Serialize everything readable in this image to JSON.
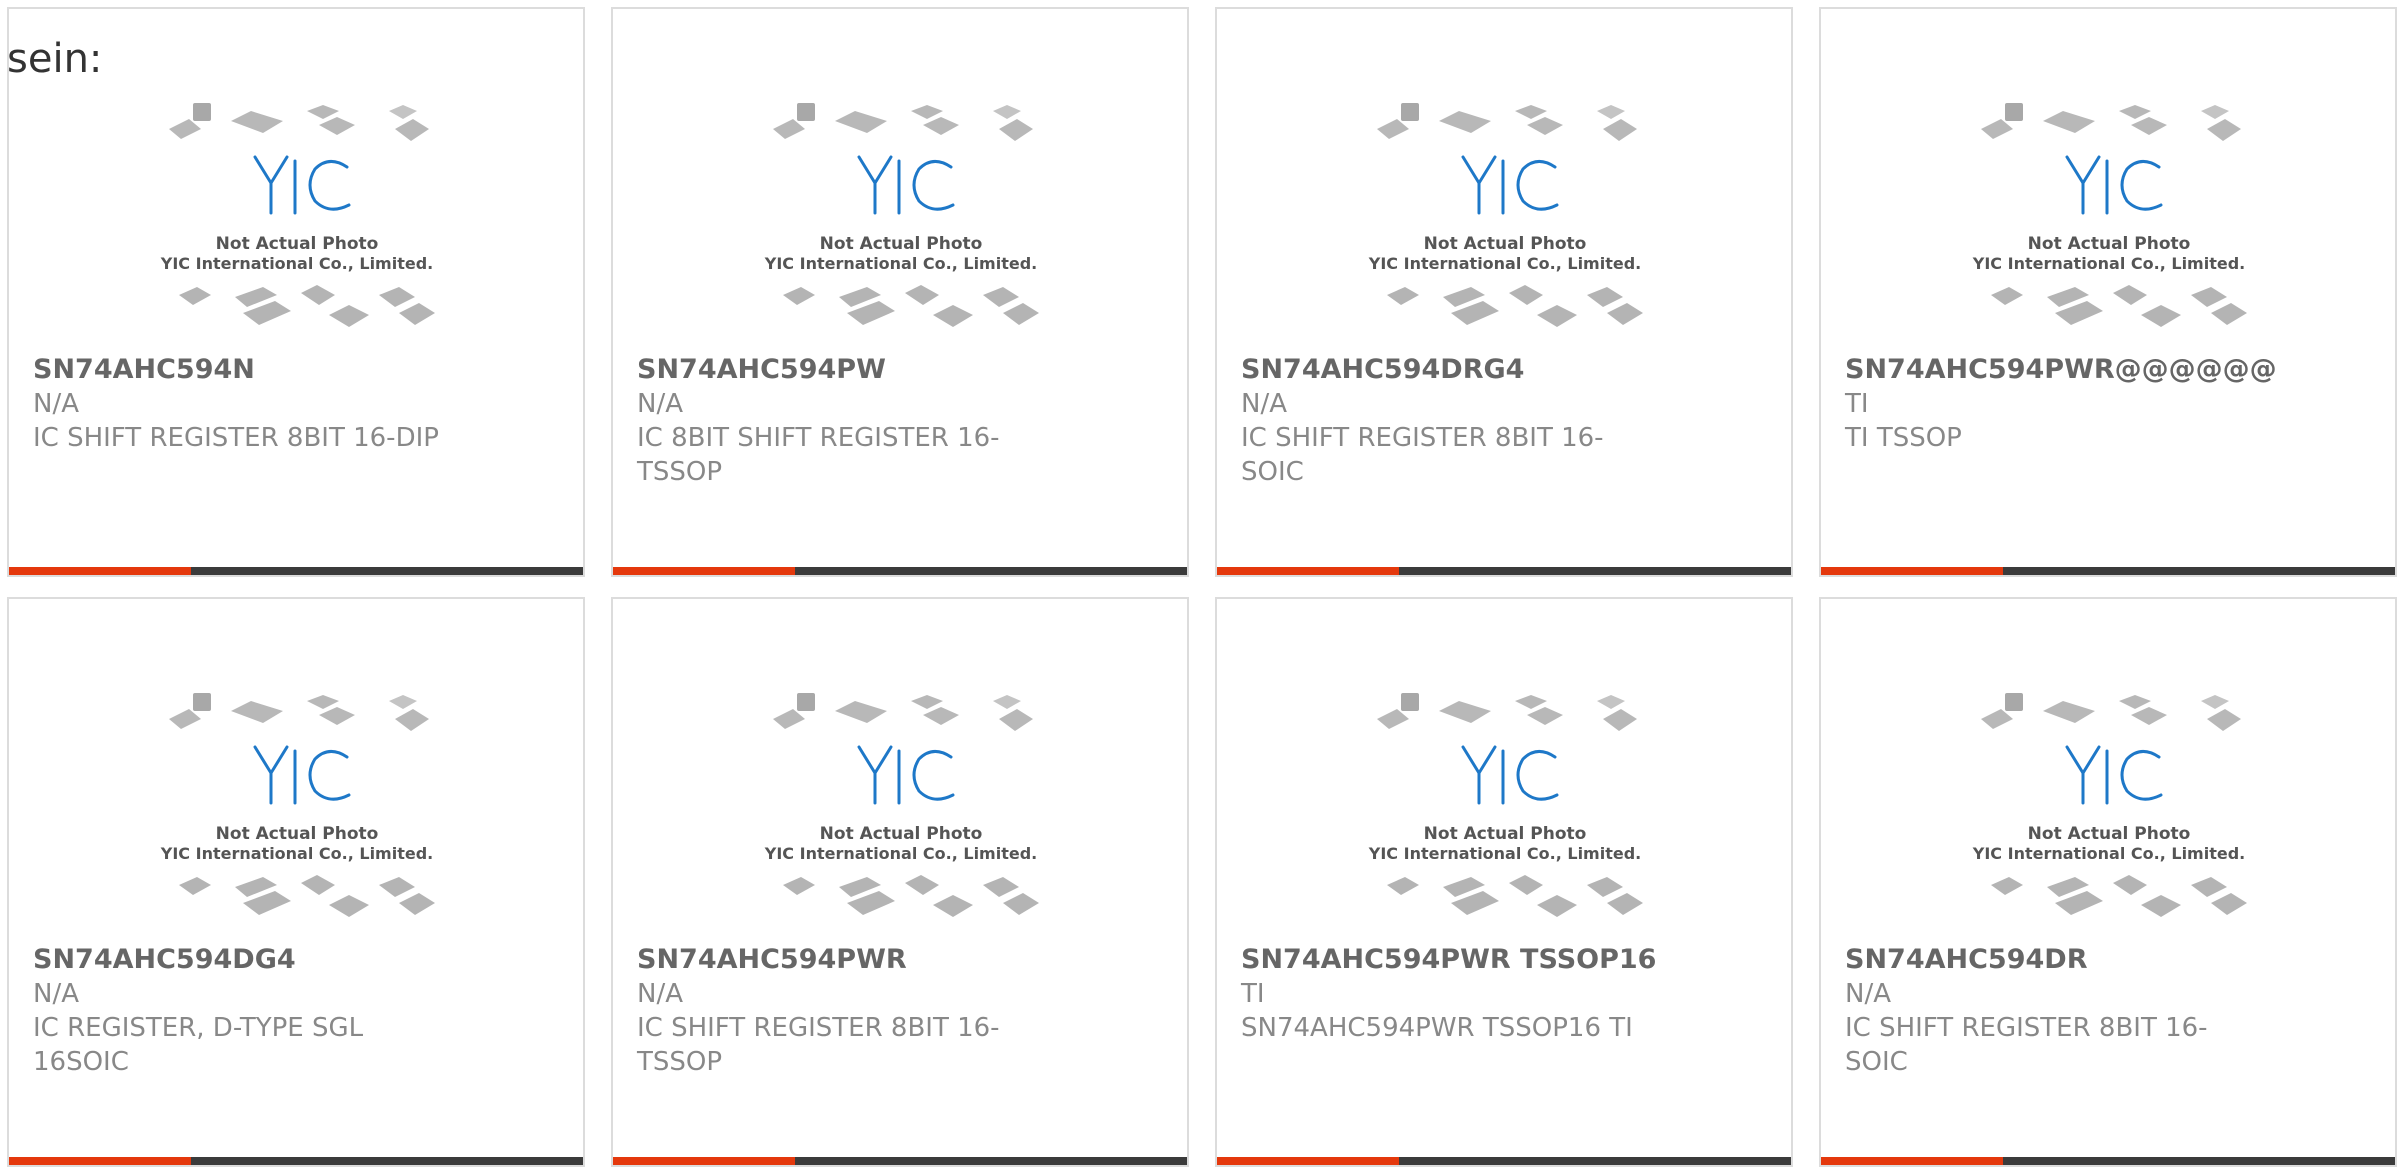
{
  "page": {
    "prefix_text": "sein:"
  },
  "image_caption": {
    "line1": "Not Actual Photo",
    "line2": "YIC International Co., Limited.",
    "logo_text": "YIC"
  },
  "colors": {
    "accent": "#e4380c",
    "bar": "#3b3b3b",
    "logo_blue": "#1e78c8",
    "border": "#dcdcdc"
  },
  "products": [
    {
      "part": "SN74AHC594N",
      "mfr": "N/A",
      "desc": "IC SHIFT REGISTER 8BIT 16-DIP"
    },
    {
      "part": "SN74AHC594PW",
      "mfr": "N/A",
      "desc": "IC 8BIT SHIFT REGISTER 16-TSSOP"
    },
    {
      "part": "SN74AHC594DRG4",
      "mfr": "N/A",
      "desc": "IC SHIFT REGISTER 8BIT 16-SOIC"
    },
    {
      "part": "SN74AHC594PWR@@@@@@",
      "mfr": "TI",
      "desc": "TI TSSOP"
    },
    {
      "part": "SN74AHC594DG4",
      "mfr": "N/A",
      "desc": "IC REGISTER, D-TYPE SGL 16SOIC"
    },
    {
      "part": "SN74AHC594PWR",
      "mfr": "N/A",
      "desc": "IC SHIFT REGISTER 8BIT 16-TSSOP"
    },
    {
      "part": "SN74AHC594PWR TSSOP16",
      "mfr": "TI",
      "desc": "SN74AHC594PWR TSSOP16 TI"
    },
    {
      "part": "SN74AHC594DR",
      "mfr": "N/A",
      "desc": "IC SHIFT REGISTER 8BIT 16-SOIC"
    }
  ]
}
